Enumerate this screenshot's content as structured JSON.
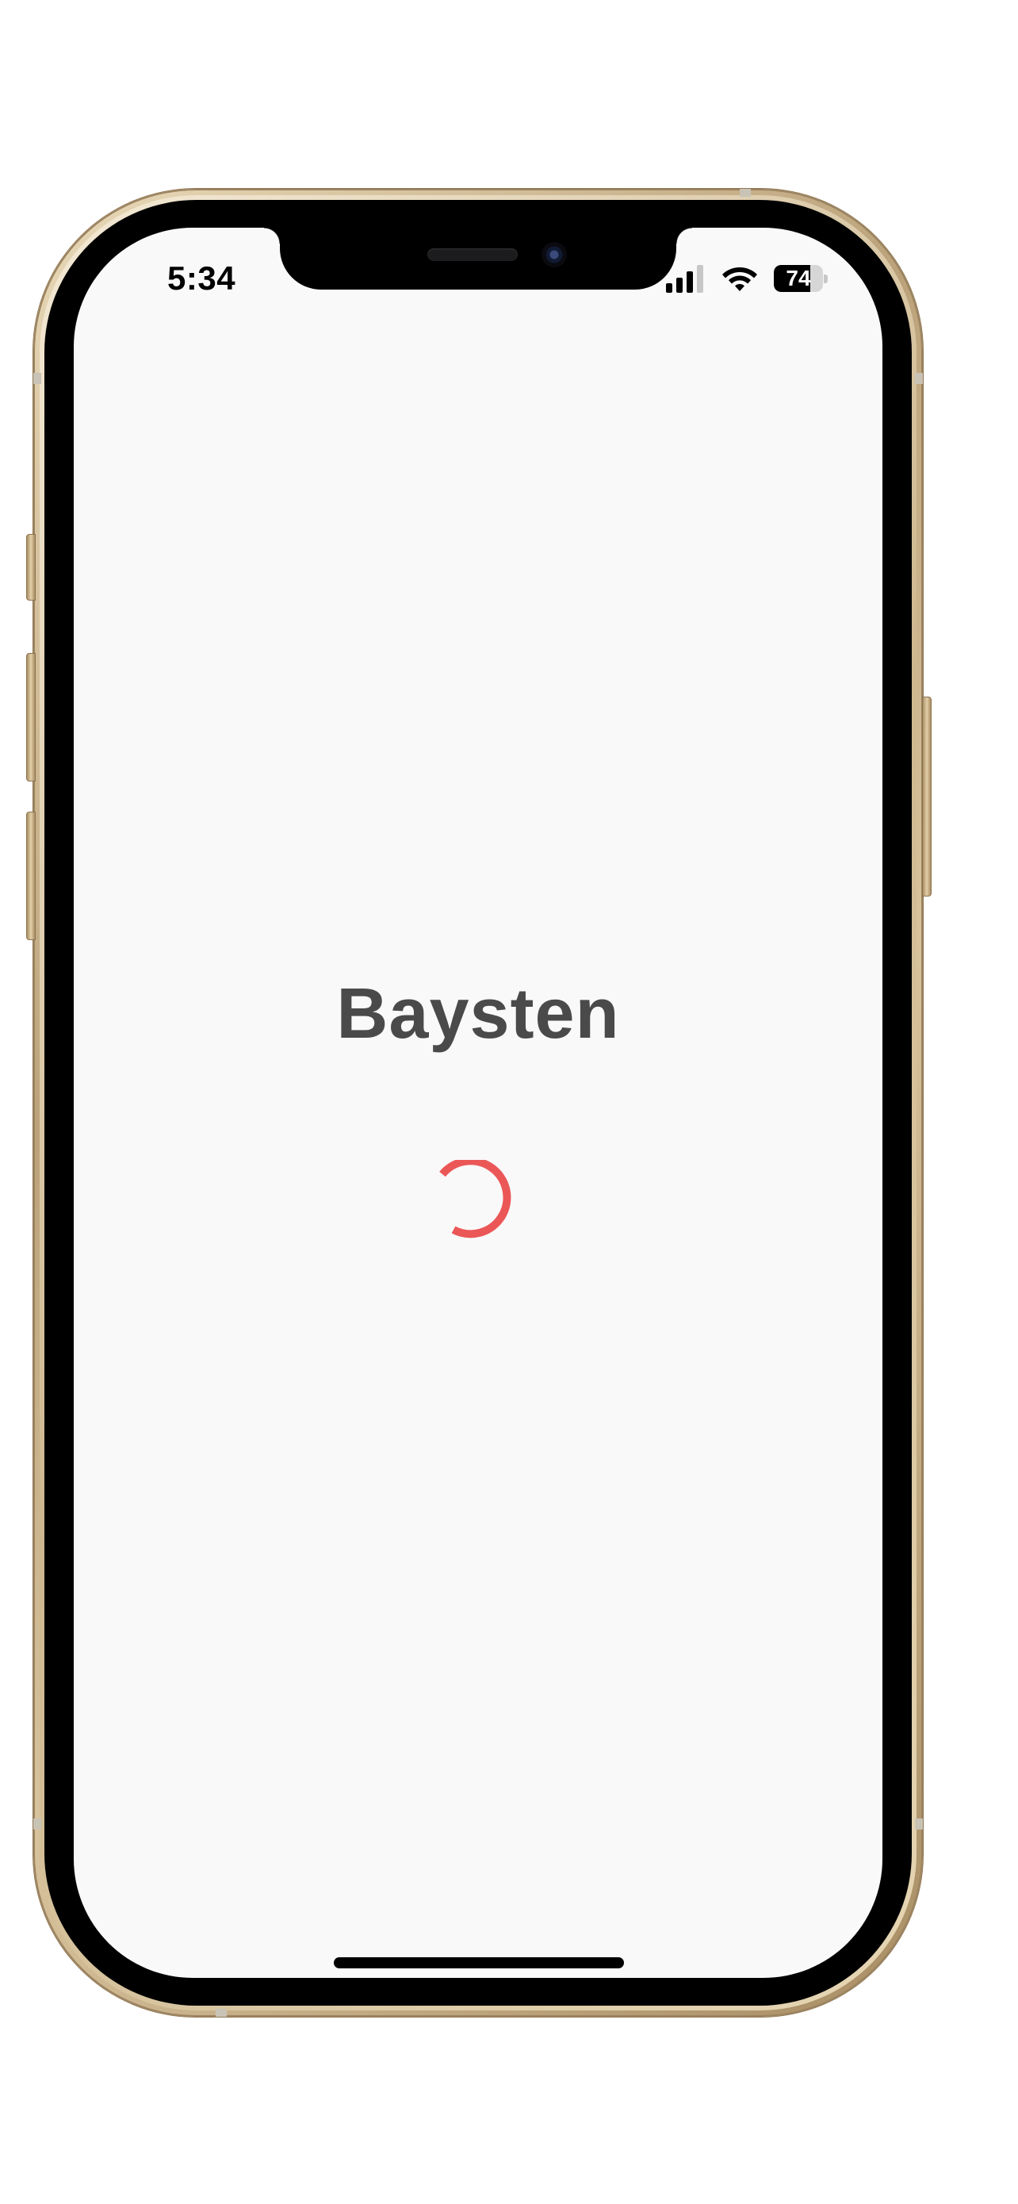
{
  "status_bar": {
    "time": "5:34",
    "battery_level": "74",
    "battery_fraction": 0.74,
    "signal_bars_active": 3,
    "signal_bars_total": 4,
    "icons": [
      "cellular-signal-icon",
      "wifi-icon",
      "battery-icon"
    ]
  },
  "splash": {
    "title": "Baysten",
    "spinner_icon": "loading-spinner-icon"
  },
  "colors": {
    "background": "#f9f9f9",
    "title": "#4a4a4a",
    "spinner": "#eb5757",
    "phone_frame": "#cdb78f"
  }
}
